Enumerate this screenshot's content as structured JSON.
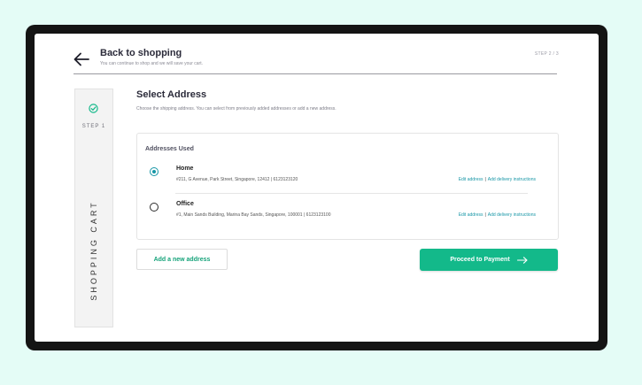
{
  "header": {
    "back_title": "Back to shopping",
    "back_subtitle": "You can continue to shop and we will save your cart.",
    "step_counter": "STEP 2 / 3",
    "back_icon": "arrow-left-icon"
  },
  "sidebar": {
    "step_label": "STEP 1",
    "vertical_label": "SHOPPING CART",
    "step_icon": "check-circle-icon"
  },
  "main": {
    "title": "Select Address",
    "subtitle": "Choose the shipping address. You can select from previously added addresses or add a new address.",
    "addresses_card": {
      "title": "Addresses Used",
      "addresses": [
        {
          "name": "Home",
          "address": "#211, G Avenue, Park Street,  Singapore, 12412   |  6123123120",
          "selected": true,
          "edit_label": "Edit address",
          "instructions_label": "Add delivery instructions"
        },
        {
          "name": "Office",
          "address": "#1, Main Sands Building, Marina Bay Sands,  Singapore, 100001   |  6123123100",
          "selected": false,
          "edit_label": "Edit address",
          "instructions_label": "Add delivery instructions"
        }
      ]
    },
    "add_address_label": "Add a new address",
    "proceed_label": "Proceed to Payment"
  },
  "colors": {
    "background": "#e4fcf6",
    "accent_green": "#13b98a",
    "link_teal": "#1796a6",
    "device_frame": "#141414"
  }
}
